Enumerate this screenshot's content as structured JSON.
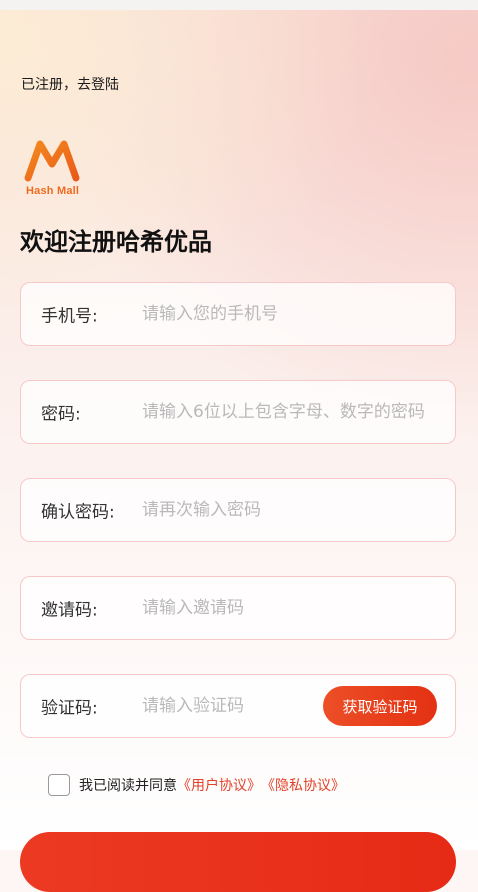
{
  "header": {
    "login_link": "已注册，去登陆"
  },
  "brand": {
    "logo_text": "Hash Mall",
    "logo_color": "#EF6B1F"
  },
  "page": {
    "title": "欢迎注册哈希优品"
  },
  "form": {
    "phone": {
      "label": "手机号:",
      "placeholder": "请输入您的手机号",
      "value": ""
    },
    "password": {
      "label": "密码:",
      "placeholder": "请输入6位以上包含字母、数字的密码",
      "value": ""
    },
    "confirm_password": {
      "label": "确认密码:",
      "placeholder": "请再次输入密码",
      "value": ""
    },
    "invite_code": {
      "label": "邀请码:",
      "placeholder": "请输入邀请码",
      "value": ""
    },
    "verify_code": {
      "label": "验证码:",
      "placeholder": "请输入验证码",
      "value": "",
      "button_label": "获取验证码"
    }
  },
  "agreement": {
    "checked": false,
    "text": "我已阅读并同意",
    "user_agreement": "《用户协议》",
    "privacy_agreement": "《隐私协议》"
  },
  "colors": {
    "accent": "#E63A1E",
    "field_border": "#F6C9C9",
    "placeholder": "#B9B9B9"
  }
}
